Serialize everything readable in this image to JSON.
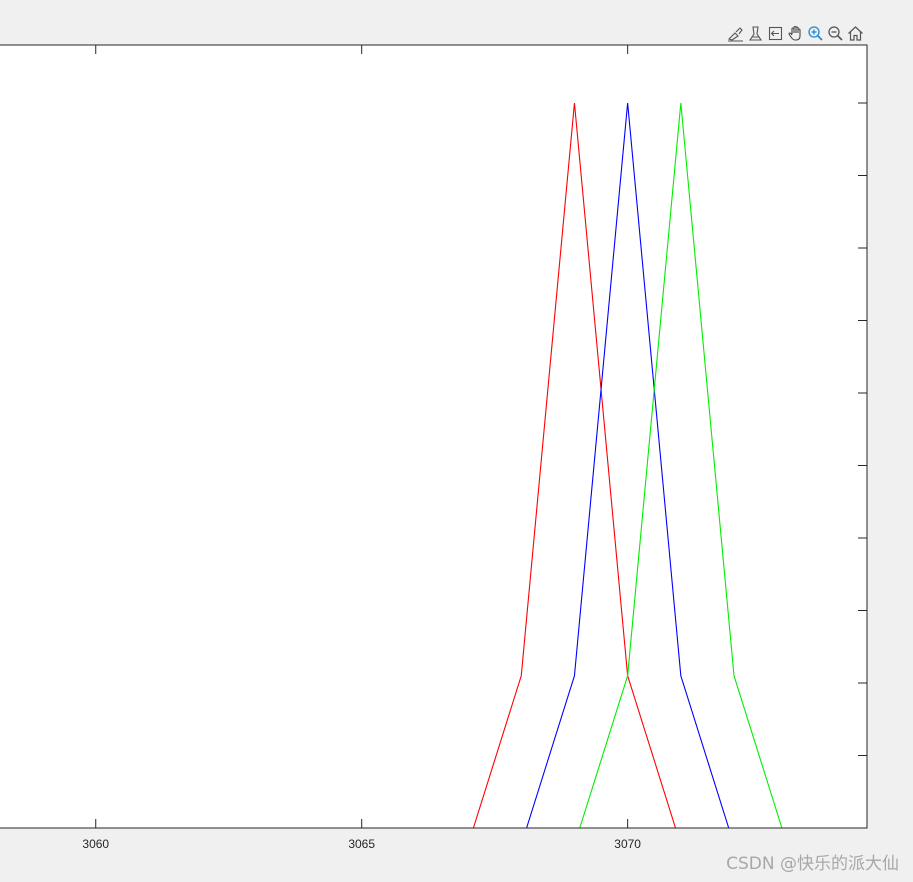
{
  "toolbar": {
    "buttons": [
      {
        "name": "brush-icon",
        "label": "Brush"
      },
      {
        "name": "data-tips-icon",
        "label": "Data Tips"
      },
      {
        "name": "restore-view-icon",
        "label": "Restore View"
      },
      {
        "name": "pan-icon",
        "label": "Pan"
      },
      {
        "name": "zoom-in-icon",
        "label": "Zoom In"
      },
      {
        "name": "zoom-out-icon",
        "label": "Zoom Out"
      },
      {
        "name": "home-icon",
        "label": "Home"
      }
    ]
  },
  "chart_data": {
    "type": "line",
    "title": "",
    "xlabel": "",
    "ylabel": "",
    "xlim": [
      3058.2,
      3074.5
    ],
    "ylim": [
      0,
      1.08
    ],
    "xticks": [
      "3060",
      "3065",
      "3070"
    ],
    "xtick_values": [
      3060,
      3065,
      3070
    ],
    "ytick_values": [
      0.1,
      0.2,
      0.3,
      0.4,
      0.5,
      0.6,
      0.7,
      0.8,
      0.9,
      1.0
    ],
    "grid": false,
    "series": [
      {
        "color": "#ff0000",
        "x": [
          3067.1,
          3068,
          3069,
          3070,
          3070.9
        ],
        "y": [
          0,
          0.21,
          1.0,
          0.21,
          0
        ]
      },
      {
        "color": "#0000ff",
        "x": [
          3068.1,
          3069,
          3070,
          3071,
          3071.9
        ],
        "y": [
          0,
          0.21,
          1.0,
          0.21,
          0
        ]
      },
      {
        "color": "#00ee00",
        "x": [
          3069.1,
          3070,
          3071,
          3072,
          3072.9
        ],
        "y": [
          0,
          0.21,
          1.0,
          0.21,
          0
        ]
      }
    ]
  },
  "watermark": "CSDN @快乐的派大仙"
}
